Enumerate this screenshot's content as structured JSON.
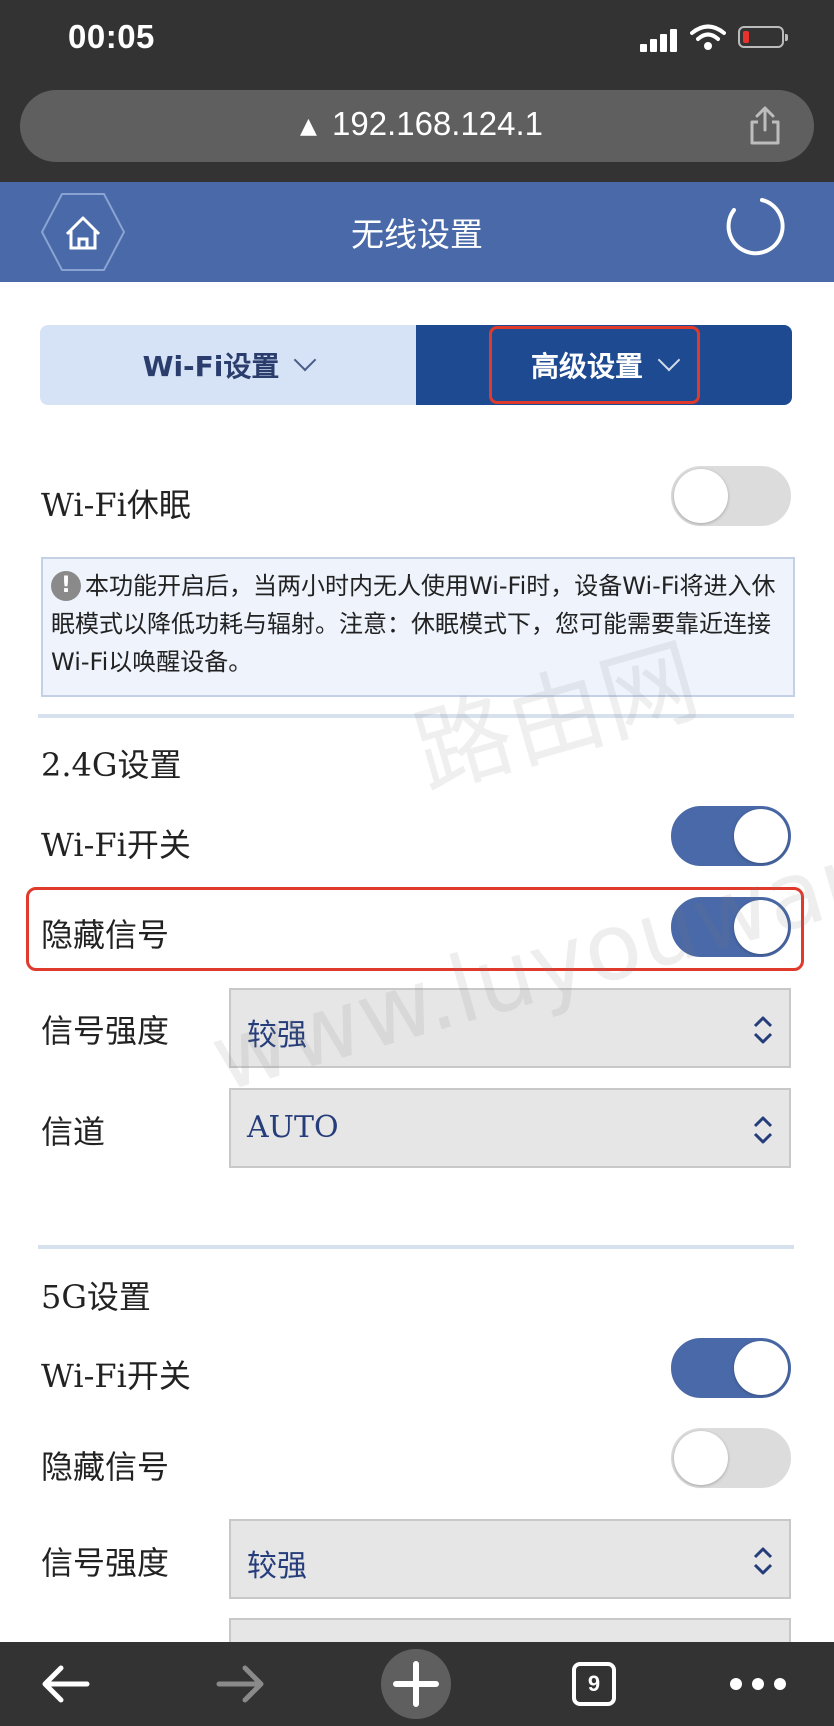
{
  "status_bar": {
    "time": "00:05"
  },
  "browser": {
    "url": "192.168.124.1",
    "tab_count": "9"
  },
  "header": {
    "title": "无线设置"
  },
  "tabs": [
    {
      "label": "Wi-Fi设置"
    },
    {
      "label": "高级设置"
    }
  ],
  "sleep": {
    "label": "Wi-Fi休眠",
    "enabled": false,
    "notice": "本功能开启后，当两小时内无人使用Wi-Fi时，设备Wi-Fi将进入休眠模式以降低功耗与辐射。注意：休眠模式下，您可能需要靠近连接Wi-Fi以唤醒设备。"
  },
  "band_24": {
    "title": "2.4G设置",
    "wifi_switch": {
      "label": "Wi-Fi开关",
      "enabled": true
    },
    "hide_ssid": {
      "label": "隐藏信号",
      "enabled": true
    },
    "signal_strength": {
      "label": "信号强度",
      "value": "较强"
    },
    "channel": {
      "label": "信道",
      "value": "AUTO"
    }
  },
  "band_5": {
    "title": "5G设置",
    "wifi_switch": {
      "label": "Wi-Fi开关",
      "enabled": true
    },
    "hide_ssid": {
      "label": "隐藏信号",
      "enabled": false
    },
    "signal_strength": {
      "label": "信号强度",
      "value": "较强"
    }
  },
  "watermark": {
    "text": "www.luyouwang.net",
    "text_cn": "路由网"
  },
  "colors": {
    "header": "#4a69a8",
    "active_tab": "#1e4a92",
    "highlight": "#e03a2c"
  }
}
